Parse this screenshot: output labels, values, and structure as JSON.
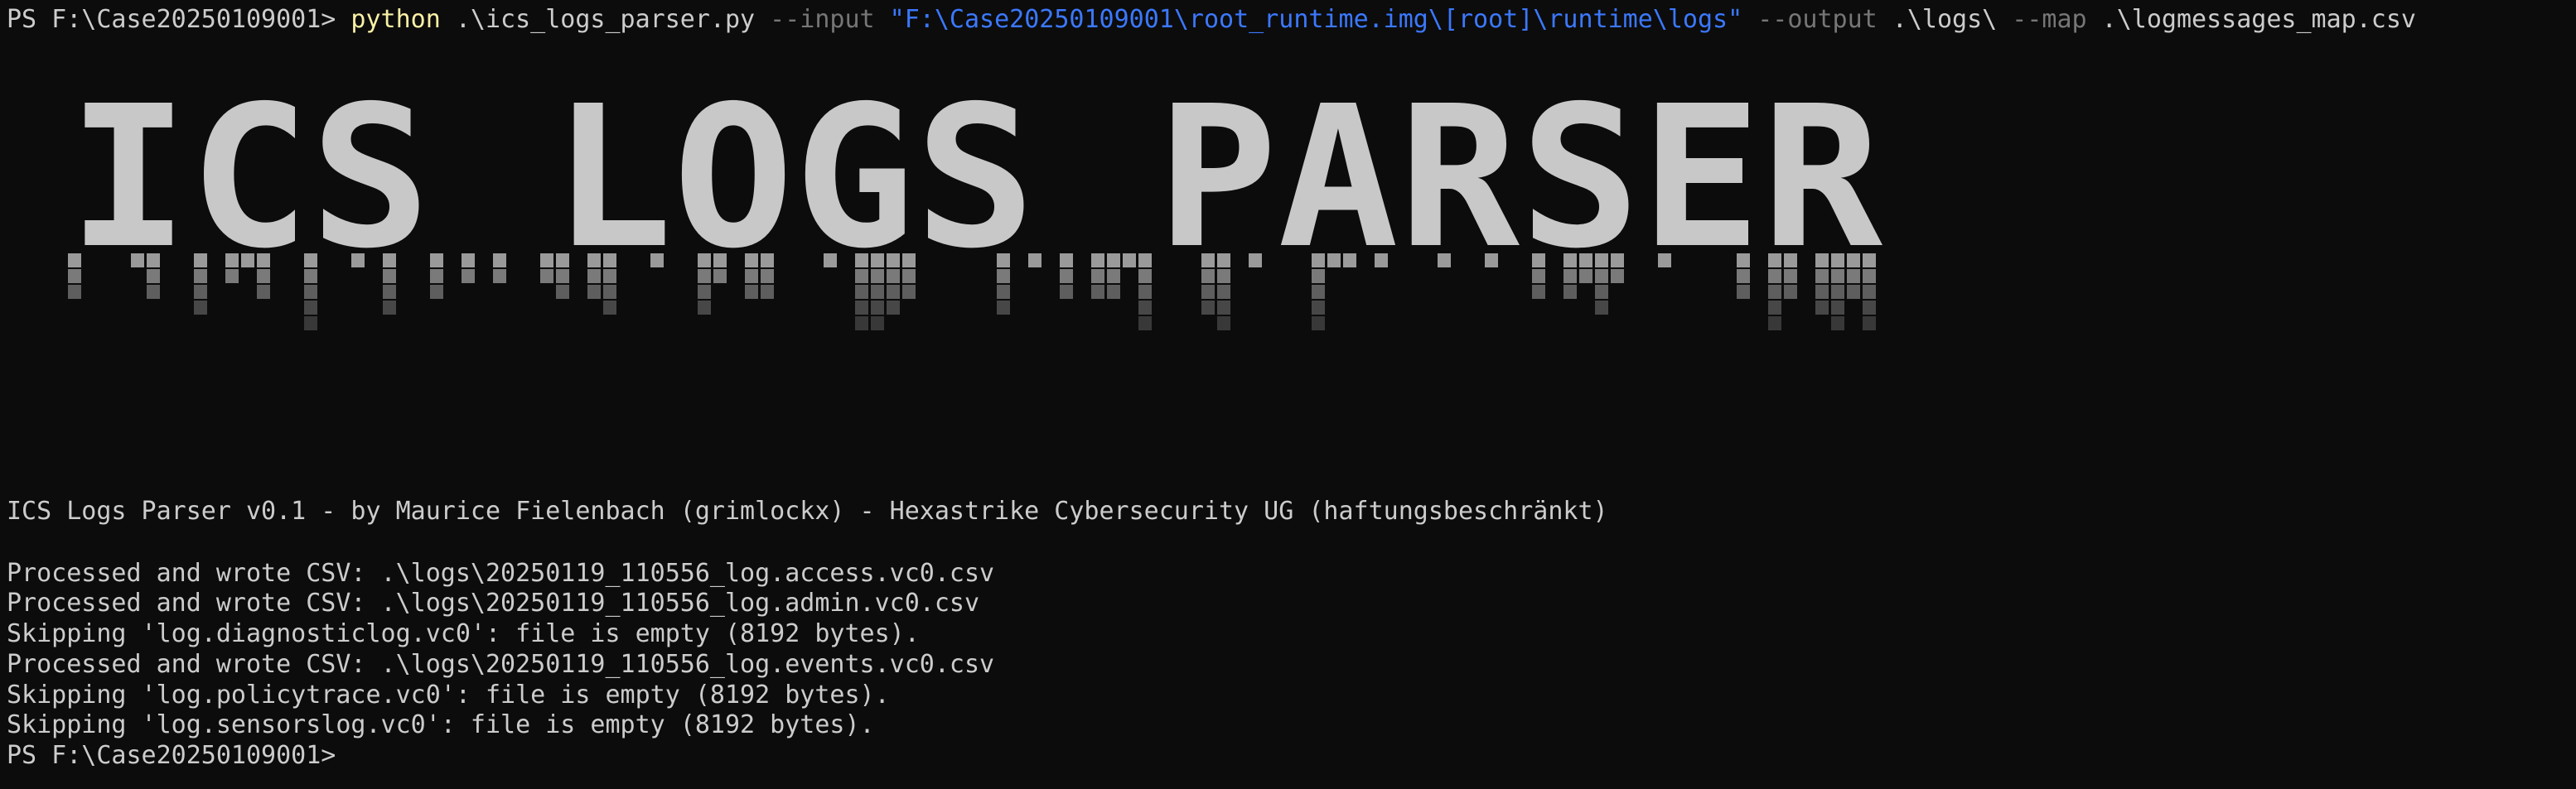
{
  "colors": {
    "background": "#0c0c0c",
    "foreground": "#cccccc",
    "command": "#f9f1a5",
    "parameter": "#767676",
    "string": "#3b78ff"
  },
  "command": {
    "prompt": "PS F:\\Case20250109001> ",
    "exe": "python",
    "script": " .\\ics_logs_parser.py ",
    "flag_input": "--input",
    "input_value": " \"F:\\Case20250109001\\root_runtime.img\\[root]\\runtime\\logs\" ",
    "flag_output": "--output",
    "output_value": " .\\logs\\ ",
    "flag_map": "--map",
    "map_value": " .\\logmessages_map.csv"
  },
  "banner": {
    "text": "ICS LOGS PARSER"
  },
  "version_line": "ICS Logs Parser v0.1 - by Maurice Fielenbach (grimlockx) - Hexastrike Cybersecurity UG (haftungsbeschränkt)",
  "output_lines": [
    "Processed and wrote CSV: .\\logs\\20250119_110556_log.access.vc0.csv",
    "Processed and wrote CSV: .\\logs\\20250119_110556_log.admin.vc0.csv",
    "Skipping 'log.diagnosticlog.vc0': file is empty (8192 bytes).",
    "Processed and wrote CSV: .\\logs\\20250119_110556_log.events.vc0.csv",
    "Skipping 'log.policytrace.vc0': file is empty (8192 bytes).",
    "Skipping 'log.sensorslog.vc0': file is empty (8192 bytes)."
  ],
  "final_prompt": "PS F:\\Case20250109001> "
}
